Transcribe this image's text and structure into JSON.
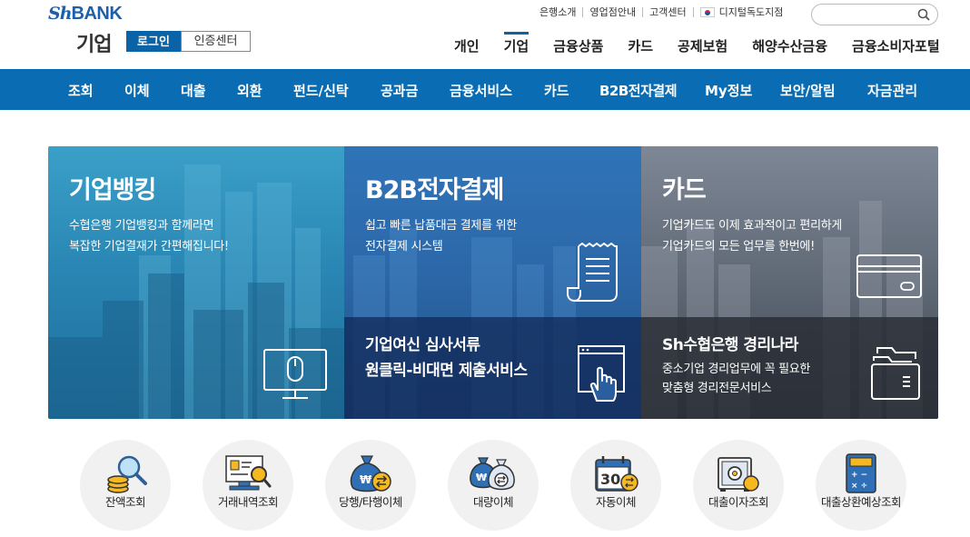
{
  "header": {
    "logo_sh": "Sh",
    "logo_bank": "BANK",
    "section_title": "기업",
    "login_label": "로그인",
    "cert_label": "인증센터",
    "util_links": [
      "은행소개",
      "영업점안내",
      "고객센터",
      "디지털독도지점"
    ],
    "search": {
      "placeholder": ""
    },
    "gnb": [
      {
        "label": "개인"
      },
      {
        "label": "기업"
      },
      {
        "label": "금융상품"
      },
      {
        "label": "카드"
      },
      {
        "label": "공제보험"
      },
      {
        "label": "해양수산금융"
      },
      {
        "label": "금융소비자포털"
      }
    ],
    "gnb_active": "기업"
  },
  "menubar": {
    "items": [
      "조회",
      "이체",
      "대출",
      "외환",
      "펀드/신탁",
      "공과금",
      "금융서비스",
      "카드",
      "B2B전자결제",
      "My정보",
      "보안/알림",
      "자금관리"
    ]
  },
  "banner": {
    "panels": [
      {
        "title": "기업뱅킹",
        "desc_lines": [
          "수협은행 기업뱅킹과 함께라면",
          "복잡한 기업결재가 간편해집니다!"
        ]
      },
      {
        "title": "B2B전자결제",
        "desc_lines": [
          "쉽고 빠른 납품대금 결제를 위한",
          "전자결제 시스템"
        ],
        "lower_title_lines": [
          "기업여신 심사서류",
          "원클릭-비대면 제출서비스"
        ]
      },
      {
        "title": "카드",
        "desc_lines": [
          "기업카드도 이제 효과적이고 편리하게",
          "기업카드의 모든 업무를 한번에!"
        ],
        "lower_title": "Sh수협은행 경리나라",
        "lower_desc_lines": [
          "중소기업 경리업무에 꼭 필요한",
          "맞춤형 경리전문서비스"
        ]
      }
    ]
  },
  "quick_menu": [
    {
      "label": "잔액조회",
      "icon": "magnifier-coins-icon"
    },
    {
      "label": "거래내역조회",
      "icon": "monitor-search-icon"
    },
    {
      "label": "당행/타행이체",
      "icon": "money-bag-exchange-icon"
    },
    {
      "label": "대량이체",
      "icon": "money-bags-exchange-icon"
    },
    {
      "label": "자동이체",
      "icon": "calendar-30-icon"
    },
    {
      "label": "대출이자조회",
      "icon": "safe-coin-icon"
    },
    {
      "label": "대출상환예상조회",
      "icon": "calculator-icon"
    }
  ],
  "colors": {
    "brand_blue": "#0a63a6",
    "menubar_blue": "#0a6db3",
    "icon_yellow": "#f5b820",
    "icon_blue": "#2f6fb5"
  }
}
